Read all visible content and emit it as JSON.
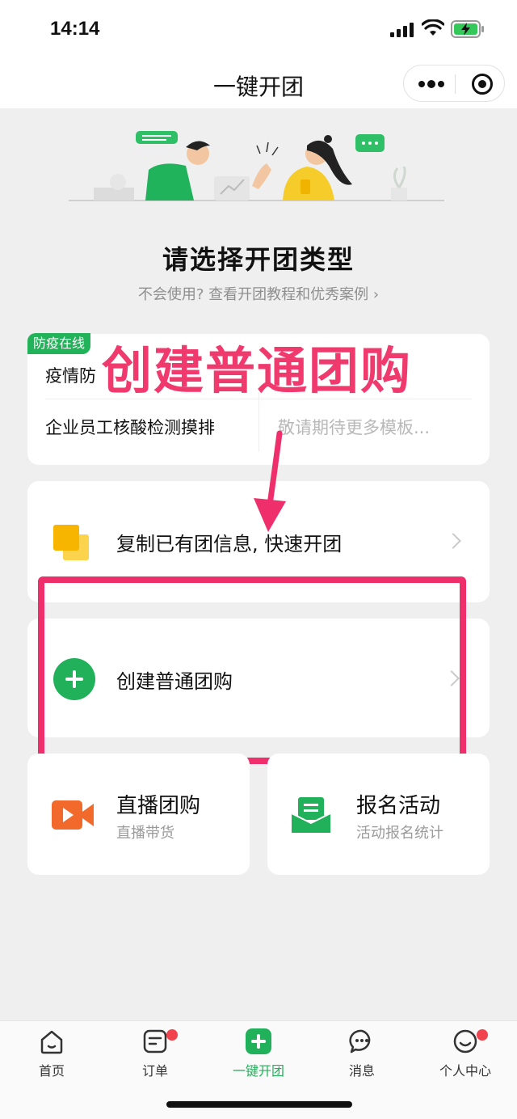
{
  "status_bar": {
    "time": "14:14"
  },
  "nav": {
    "title": "一键开团"
  },
  "hero": {
    "heading": "请选择开团类型",
    "help_link": "不会使用? 查看开团教程和优秀案例 ›"
  },
  "template_card": {
    "badge": "防疫在线",
    "item1": "疫情防",
    "item2": "企业员工核酸检测摸排",
    "item3": "敬请期待更多模板..."
  },
  "annotation": {
    "overlay_text": "创建普通团购"
  },
  "options": {
    "copy_label": "复制已有团信息, 快速开团",
    "create_label": "创建普通团购",
    "live": {
      "title": "直播团购",
      "desc": "直播带货"
    },
    "register": {
      "title": "报名活动",
      "desc": "活动报名统计"
    }
  },
  "tabs": [
    {
      "label": "首页",
      "icon": "home-icon"
    },
    {
      "label": "订单",
      "icon": "order-icon",
      "dot": true
    },
    {
      "label": "一键开团",
      "icon": "plus-icon",
      "active": true
    },
    {
      "label": "消息",
      "icon": "message-icon"
    },
    {
      "label": "个人中心",
      "icon": "profile-icon",
      "dot": true
    }
  ],
  "colors": {
    "accent": "#20b15a",
    "annotation": "#ee2f6b",
    "copy_icon": "#f7b500",
    "live_icon": "#f26a2b"
  }
}
